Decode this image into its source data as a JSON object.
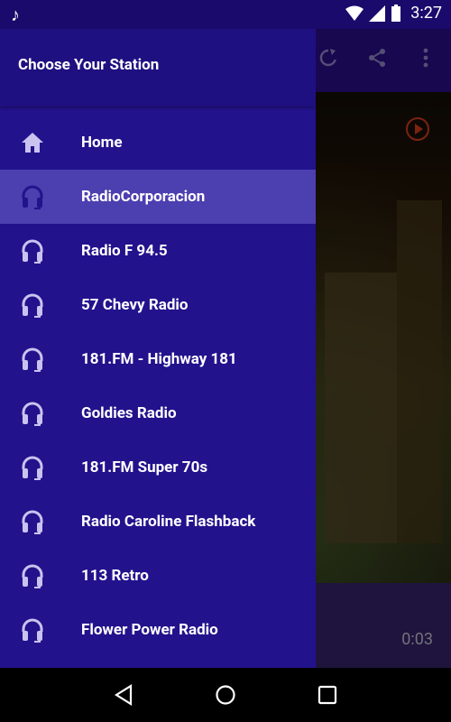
{
  "status_bar": {
    "time": "3:27"
  },
  "drawer": {
    "title": "Choose Your Station",
    "items": [
      {
        "label": "Home",
        "icon": "home-icon"
      },
      {
        "label": "RadioCorporacion",
        "icon": "headphones-icon",
        "active": true
      },
      {
        "label": "Radio F 94.5",
        "icon": "headphones-icon"
      },
      {
        "label": "57 Chevy Radio",
        "icon": "headphones-icon"
      },
      {
        "label": "181.FM - Highway 181",
        "icon": "headphones-icon"
      },
      {
        "label": "Goldies Radio",
        "icon": "headphones-icon"
      },
      {
        "label": "181.FM Super 70s",
        "icon": "headphones-icon"
      },
      {
        "label": "Radio Caroline Flashback",
        "icon": "headphones-icon"
      },
      {
        "label": "113 Retro",
        "icon": "headphones-icon"
      },
      {
        "label": "Flower Power Radio",
        "icon": "headphones-icon"
      }
    ]
  },
  "player": {
    "elapsed": "0:03"
  },
  "colors": {
    "drawer_bg": "#22128c",
    "active_item": "#4c3fb0",
    "icon_tint": "#c9c3ef",
    "toolbar": "#2a1090"
  }
}
